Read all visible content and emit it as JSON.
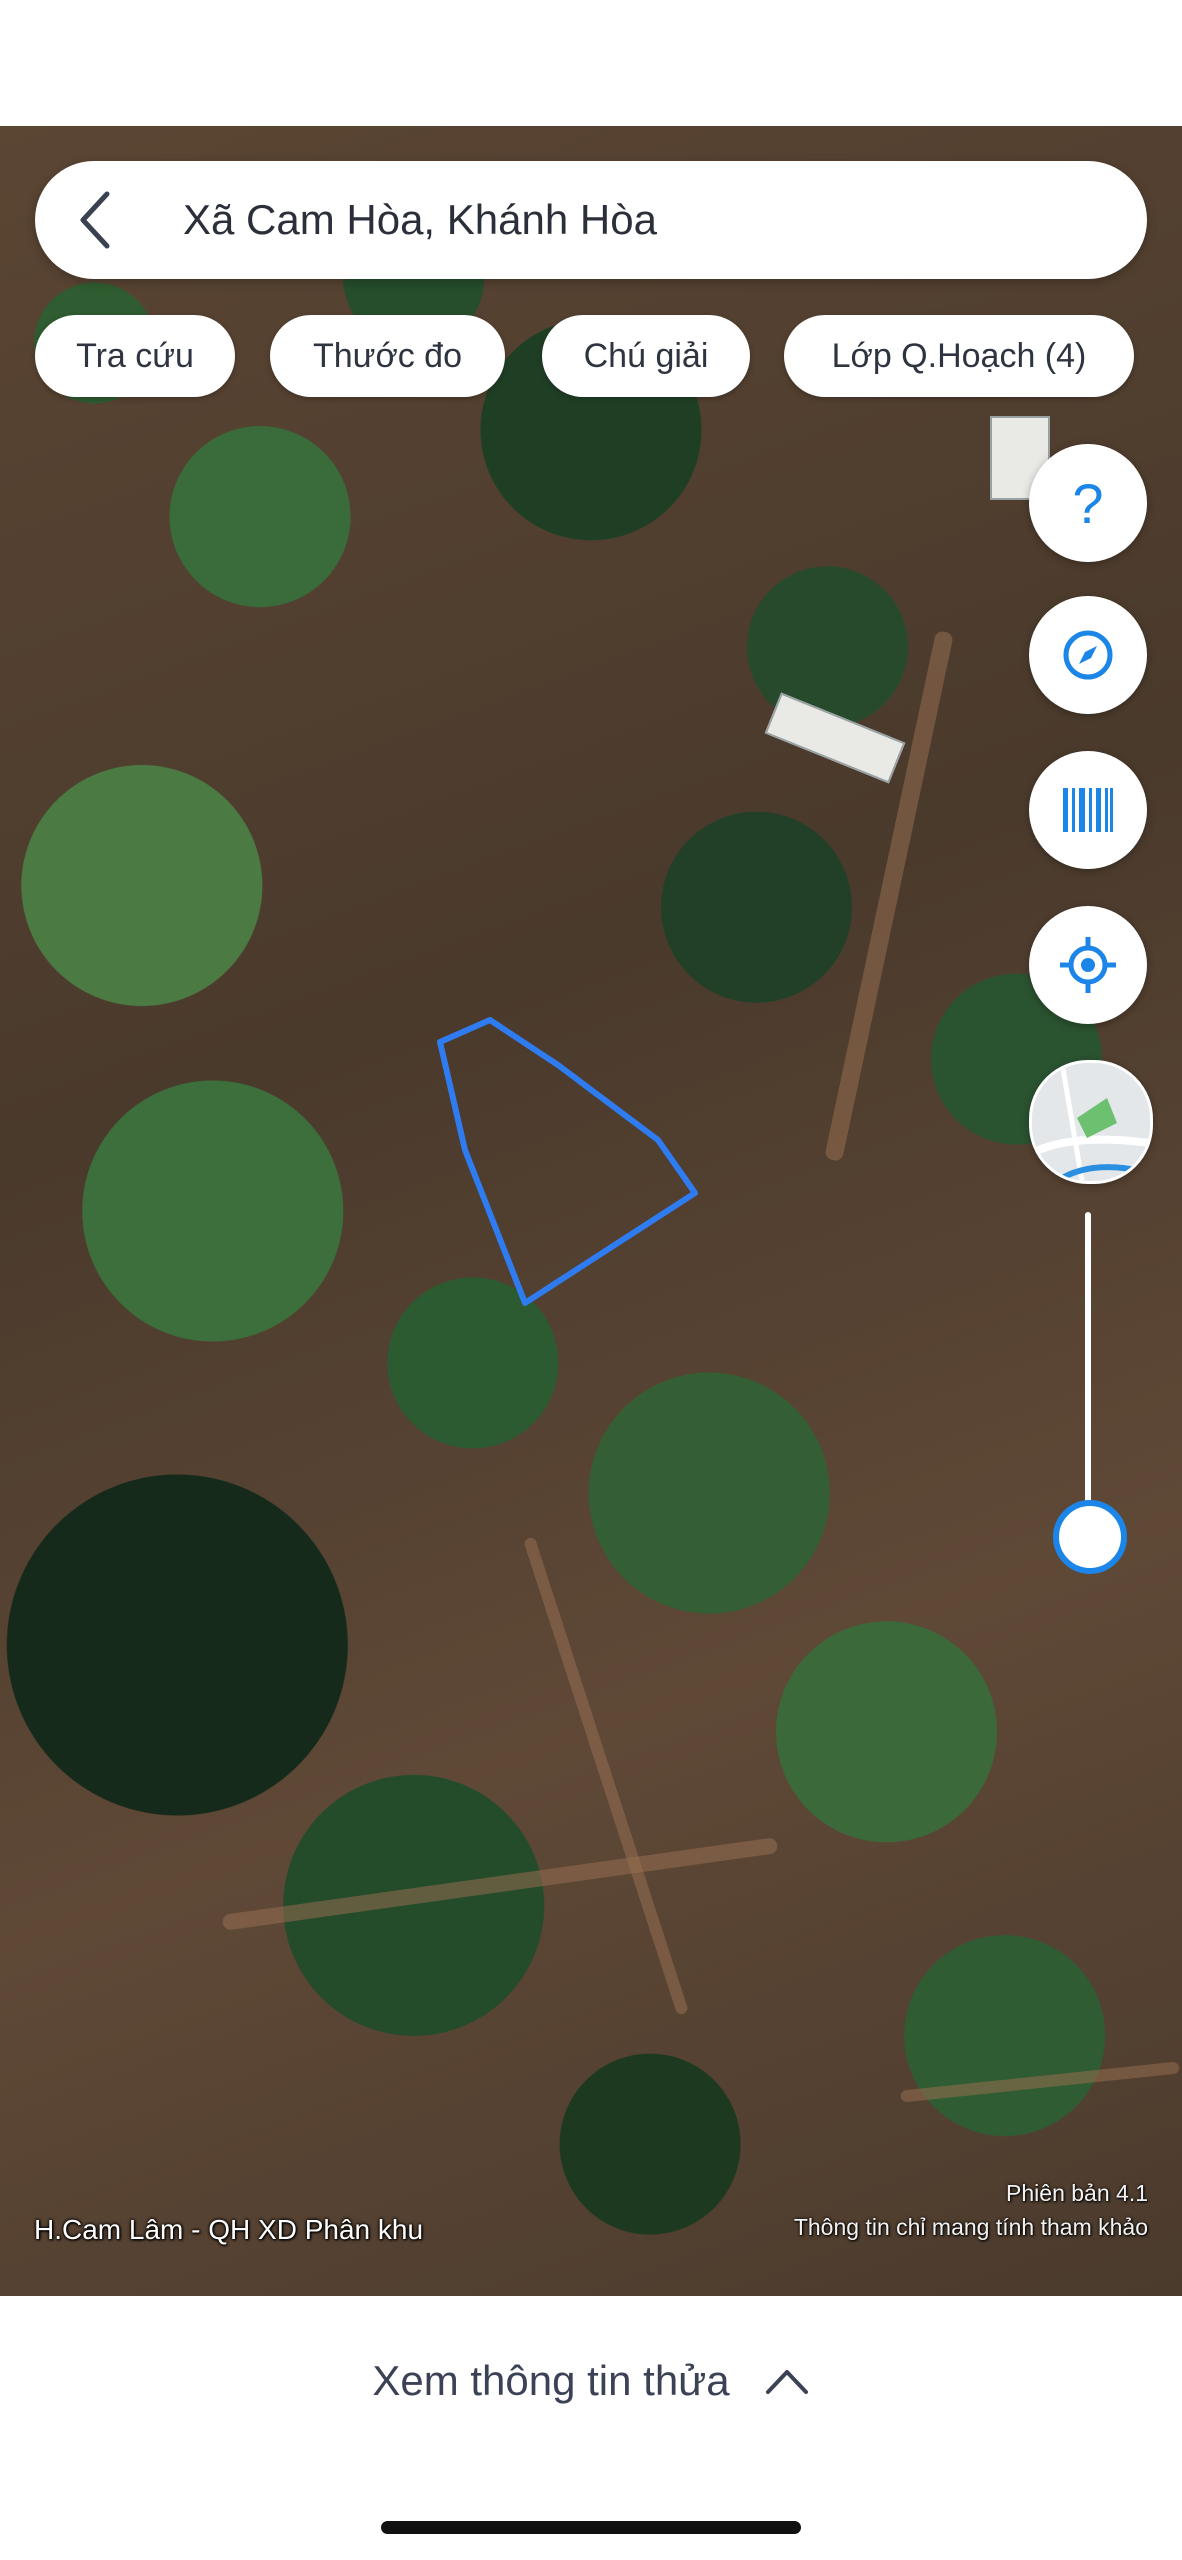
{
  "search": {
    "text": "Xã Cam Hòa, Khánh Hòa"
  },
  "chips": [
    {
      "label": "Tra cứu"
    },
    {
      "label": "Thước đo"
    },
    {
      "label": "Chú giải"
    },
    {
      "label": "Lớp Q.Hoạch (4)"
    }
  ],
  "side_buttons": [
    {
      "icon": "help-icon"
    },
    {
      "icon": "compass-icon"
    },
    {
      "icon": "barcode-icon"
    },
    {
      "icon": "locate-icon"
    },
    {
      "icon": "map-thumbnail"
    }
  ],
  "slider": {
    "value": 0.0
  },
  "map": {
    "plan_label": "H.Cam Lâm - QH XD Phân khu",
    "version": "Phiên bản 4.1",
    "disclaimer": "Thông tin chỉ mang tính tham khảo",
    "parcel_outline_color": "#2f7bf0"
  },
  "bottom": {
    "label": "Xem thông tin thửa",
    "icon": "chevron-up-icon"
  },
  "colors": {
    "accent": "#1c86e8",
    "text": "#2e3440"
  }
}
